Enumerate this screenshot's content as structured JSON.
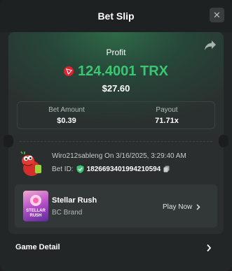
{
  "header": {
    "title": "Bet Slip",
    "close_glyph": "✕"
  },
  "profit": {
    "label": "Profit",
    "amount": "124.4001 TRX",
    "usd": "$27.60",
    "currency_icon": "trx-icon",
    "accent_color": "#3bc771"
  },
  "stats": {
    "bet_amount_label": "Bet Amount",
    "bet_amount_value": "$0.39",
    "payout_label": "Payout",
    "payout_value": "71.71x"
  },
  "bet": {
    "user_line": "Wiro212sableng On 3/16/2025, 3:29:40 AM",
    "bet_id_label": "Bet ID:",
    "bet_id_value": "1826693401994210594"
  },
  "game": {
    "name": "Stellar Rush",
    "provider": "BC Brand",
    "play_label": "Play Now",
    "thumb_line1": "STELLAR",
    "thumb_line2": "RUSH"
  },
  "footer": {
    "game_detail_label": "Game Detail"
  }
}
